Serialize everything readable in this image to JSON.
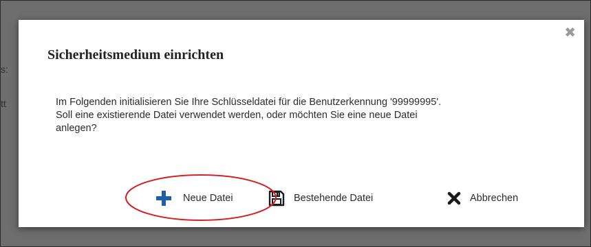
{
  "background": {
    "fragment_1": "s:",
    "fragment_2": "tt"
  },
  "dialog": {
    "title": "Sicherheitsmedium einrichten",
    "close_symbol": "✖",
    "message_line_1": "Im Folgenden initialisieren Sie Ihre Schlüsseldatei für die Benutzerkennung '99999995'.",
    "message_line_2": "Soll eine existierende Datei verwendet werden, oder möchten Sie eine neue Datei",
    "message_line_3": "anlegen?",
    "buttons": {
      "new_label": "Neue Datei",
      "existing_label": "Bestehende Datei",
      "cancel_label": "Abbrechen"
    }
  },
  "icons": {
    "new": "plus-icon",
    "existing": "floppy-disk-icon",
    "cancel": "x-icon",
    "close": "close-icon"
  },
  "colors": {
    "overlay": "#6e6e6e",
    "plus_icon": "#1f5ea8",
    "highlight_ellipse": "#d42020",
    "close_icon": "#9a9a9a"
  }
}
